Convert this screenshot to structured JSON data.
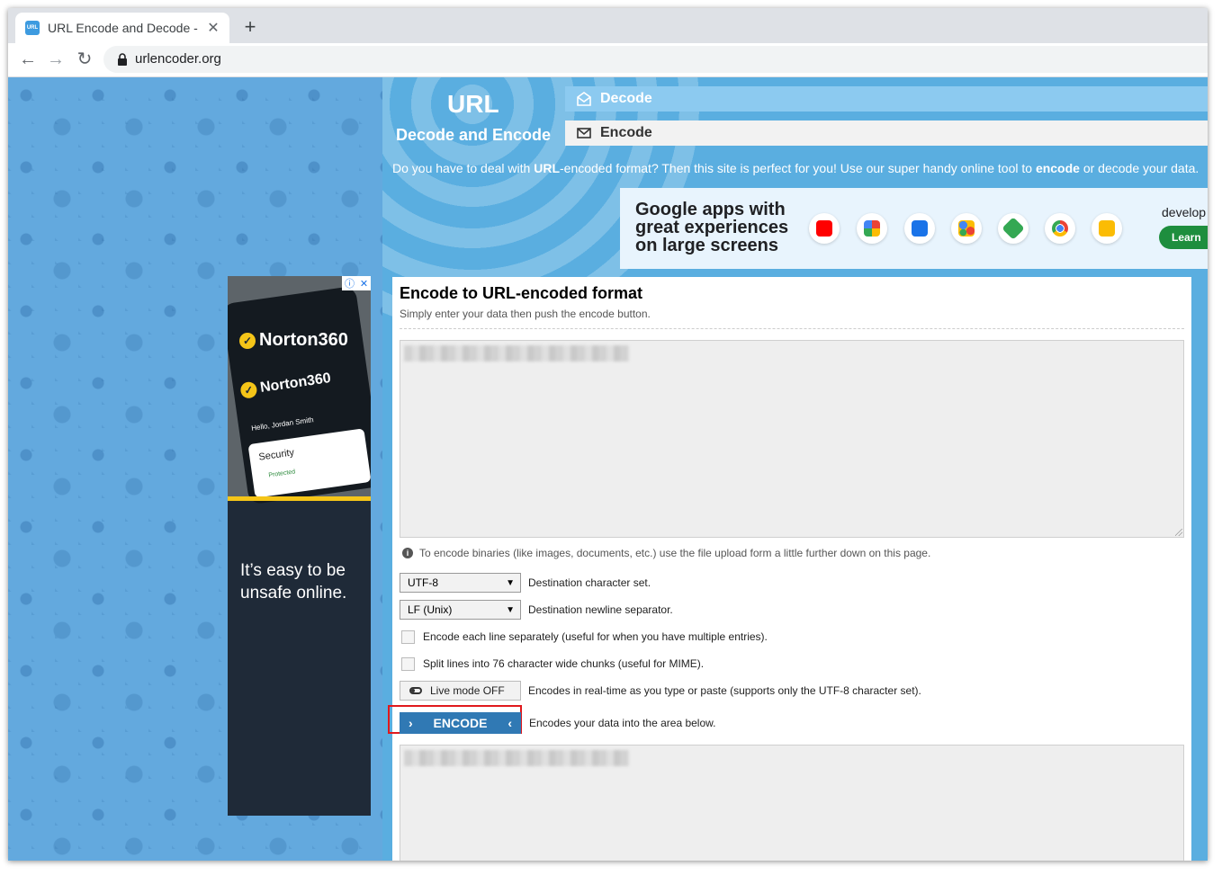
{
  "browser": {
    "tab_title": "URL Encode and Decode - ",
    "favicon_text": "URL",
    "tab_close": "✕",
    "new_tab": "+",
    "back": "←",
    "forward": "→",
    "reload": "↻",
    "url": "urlencoder.org"
  },
  "site": {
    "logo_main": "URL",
    "logo_sub": "Decode and Encode",
    "nav": {
      "decode": "Decode",
      "encode": "Encode"
    },
    "intro": {
      "p1": "Do you have to deal with ",
      "b1": "URL",
      "p2": "-encoded format? Then this site is perfect for you! Use our super handy online tool to ",
      "b2": "encode",
      "p3": " or decode your data."
    }
  },
  "google_ad": {
    "headline": "Google apps with great experiences on large screens",
    "dev_text": "develop",
    "learn_label": "Learn",
    "app_colors": [
      "#ff0000",
      "#fbbc04",
      "#1a73e8",
      "#4285f4",
      "#34a853",
      "#ea4335",
      "#fbbc04"
    ]
  },
  "panel": {
    "title": "Encode to URL-encoded format",
    "subtitle": "Simply enter your data then push the encode button.",
    "hint": "To encode binaries (like images, documents, etc.) use the file upload form a little further down on this page.",
    "charset": {
      "value": "UTF-8",
      "label": "Destination character set."
    },
    "newline": {
      "value": "LF (Unix)",
      "label": "Destination newline separator."
    },
    "each_line_label": "Encode each line separately (useful for when you have multiple entries).",
    "split_lines_label": "Split lines into 76 character wide chunks (useful for MIME).",
    "live_mode": {
      "button": "Live mode OFF",
      "label": "Encodes in real-time as you type or paste (supports only the UTF-8 character set)."
    },
    "encode": {
      "button": "ENCODE",
      "label": "Encodes your data into the area below."
    }
  },
  "norton_ad": {
    "brand": "Norton360",
    "greeting": "Hello, Jordan Smith",
    "security": "Security",
    "protected": "Protected",
    "slogan": "It’s easy to be unsafe online.",
    "info_glyph": "ⓘ",
    "close_glyph": "✕"
  }
}
